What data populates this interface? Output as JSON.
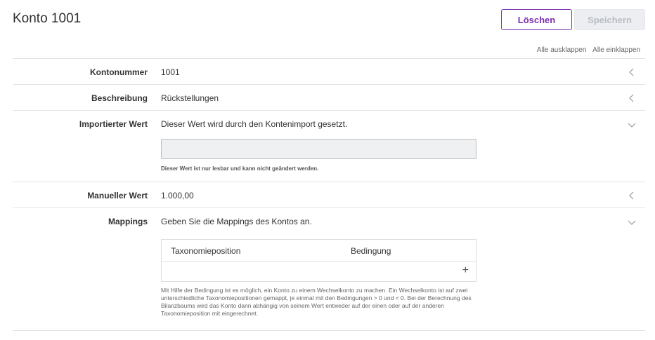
{
  "header": {
    "title": "Konto 1001",
    "delete_label": "Löschen",
    "save_label": "Speichern"
  },
  "expand": {
    "expand_all": "Alle ausklappen",
    "collapse_all": "Alle einklappen"
  },
  "rows": {
    "kontonummer": {
      "label": "Kontonummer",
      "value": "1001"
    },
    "beschreibung": {
      "label": "Beschreibung",
      "value": "Rückstellungen"
    },
    "importiert": {
      "label": "Importierter Wert",
      "value": "Dieser Wert wird durch den Kontenimport gesetzt.",
      "field_value": "",
      "hint": "Dieser Wert ist nur lesbar und kann nicht geändert werden."
    },
    "manuell": {
      "label": "Manueller Wert",
      "value": "1.000,00"
    },
    "mappings": {
      "label": "Mappings",
      "value": "Geben Sie die Mappings des Kontos an.",
      "col_taxonomie": "Taxonomieposition",
      "col_bedingung": "Bedingung",
      "add_symbol": "+",
      "hint": "Mit Hilfe der Bedingung ist es möglich, ein Konto zu einem Wechselkonto zu machen. Ein Wechselkonto ist auf zwei unterschiedliche Taxonomiepositionen gemappt, je einmal mit den Bedingungen > 0 und < 0. Bei der Berechnung des Bilanzbaums wird das Konto dann abhängig von seinem Wert entweder auf der einen oder auf der anderen Taxonomieposition mit eingerechnet."
    }
  },
  "icons": {
    "collapsed": "chevron-left-icon",
    "expanded": "chevron-down-icon"
  },
  "colors": {
    "accent": "#7b2fb0",
    "disabled_bg": "#eceef1",
    "disabled_text": "#b8bcc4"
  }
}
